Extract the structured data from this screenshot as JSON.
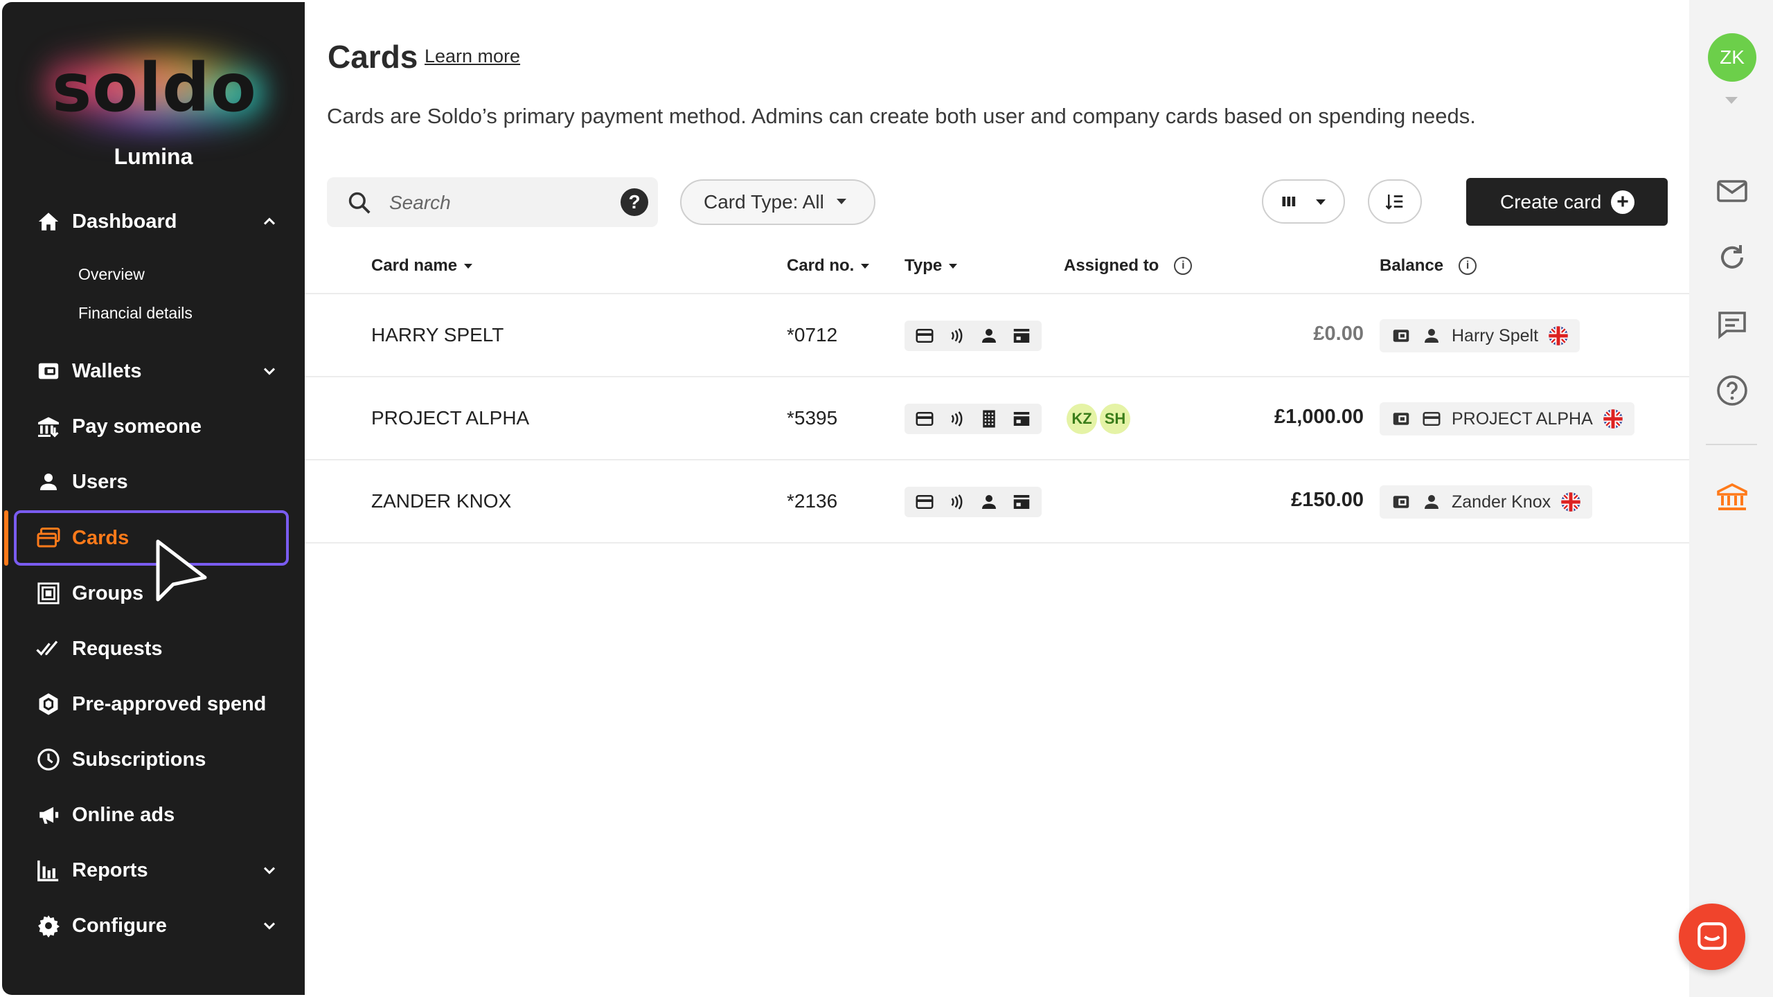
{
  "sidebar": {
    "logo": "soldo",
    "org_name": "Lumina",
    "items": [
      {
        "label": "Dashboard",
        "icon": "home-icon",
        "expanded": true
      },
      {
        "label": "Wallets",
        "icon": "wallet-icon"
      },
      {
        "label": "Pay someone",
        "icon": "bank-transfer-icon"
      },
      {
        "label": "Users",
        "icon": "user-icon"
      },
      {
        "label": "Cards",
        "icon": "cards-icon",
        "active": true
      },
      {
        "label": "Groups",
        "icon": "groups-icon"
      },
      {
        "label": "Requests",
        "icon": "double-check-icon"
      },
      {
        "label": "Pre-approved spend",
        "icon": "hexagon-icon"
      },
      {
        "label": "Subscriptions",
        "icon": "clock-icon"
      },
      {
        "label": "Online ads",
        "icon": "megaphone-icon"
      },
      {
        "label": "Reports",
        "icon": "bar-chart-icon"
      },
      {
        "label": "Configure",
        "icon": "gear-icon"
      }
    ],
    "dashboard_sub": [
      "Overview",
      "Financial details"
    ]
  },
  "main": {
    "title": "Cards",
    "learn_more": "Learn more",
    "description": "Cards are Soldo’s primary payment method. Admins can create both user and company cards based on spending needs.",
    "search_placeholder": "Search",
    "card_type_filter": "Card Type: All",
    "create_button": "Create card"
  },
  "table": {
    "headers": {
      "card_name": "Card name",
      "card_no": "Card no.",
      "type": "Type",
      "assigned_to": "Assigned to",
      "balance": "Balance"
    },
    "rows": [
      {
        "card_name": "HARRY SPELT",
        "card_no": "*0712",
        "assigned": [],
        "balance": "£0.00",
        "owner": "Harry Spelt",
        "owner_type": "user"
      },
      {
        "card_name": "PROJECT ALPHA",
        "card_no": "*5395",
        "assigned": [
          "KZ",
          "SH"
        ],
        "balance": "£1,000.00",
        "owner": "PROJECT ALPHA",
        "owner_type": "company"
      },
      {
        "card_name": "ZANDER KNOX",
        "card_no": "*2136",
        "assigned": [],
        "balance": "£150.00",
        "owner": "Zander Knox",
        "owner_type": "user"
      }
    ]
  },
  "rightbar": {
    "user_initials": "ZK"
  },
  "colors": {
    "accent": "#ff7a1a",
    "active_outline": "#7a5cf0",
    "sidebar_bg": "#1d1d1d",
    "avatar_green": "#6ccf4a",
    "chat_red": "#f0442c"
  }
}
